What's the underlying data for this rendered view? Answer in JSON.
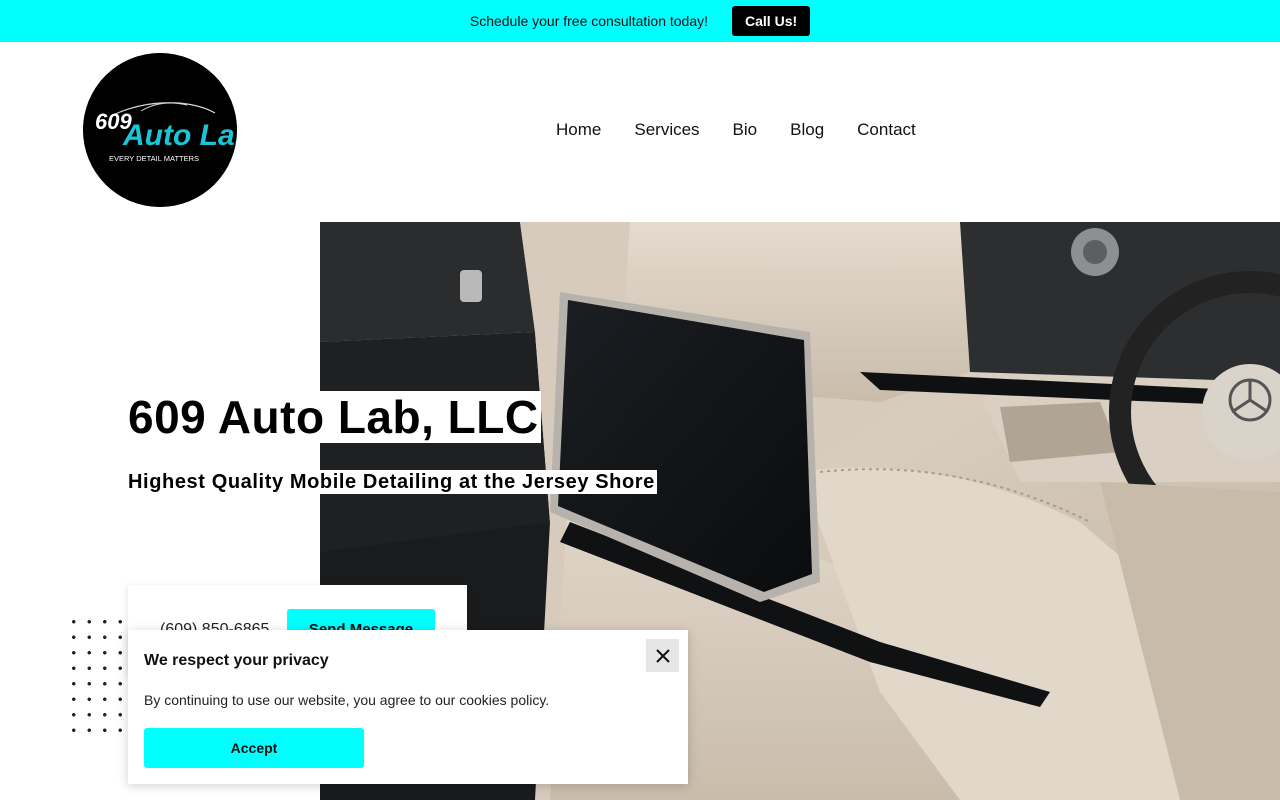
{
  "topbar": {
    "text": "Schedule your free consultation today!",
    "call_label": "Call Us!"
  },
  "logo": {
    "number": "609",
    "name": "Auto Lab",
    "tagline": "EVERY DETAIL MATTERS"
  },
  "nav": {
    "items": [
      "Home",
      "Services",
      "Bio",
      "Blog",
      "Contact"
    ]
  },
  "hero": {
    "title": "609 Auto Lab, LLC",
    "subtitle": "Highest Quality Mobile Detailing at the Jersey Shore",
    "image_icon": "car-interior-photo"
  },
  "contact": {
    "phone": "(609) 850-6865",
    "send_label": "Send Message"
  },
  "cookie": {
    "title": "We respect your privacy",
    "text": "By continuing to use our website, you agree to our cookies policy.",
    "accept_label": "Accept",
    "close_icon": "close-icon"
  },
  "colors": {
    "accent": "#00ffff",
    "dark": "#000000"
  }
}
